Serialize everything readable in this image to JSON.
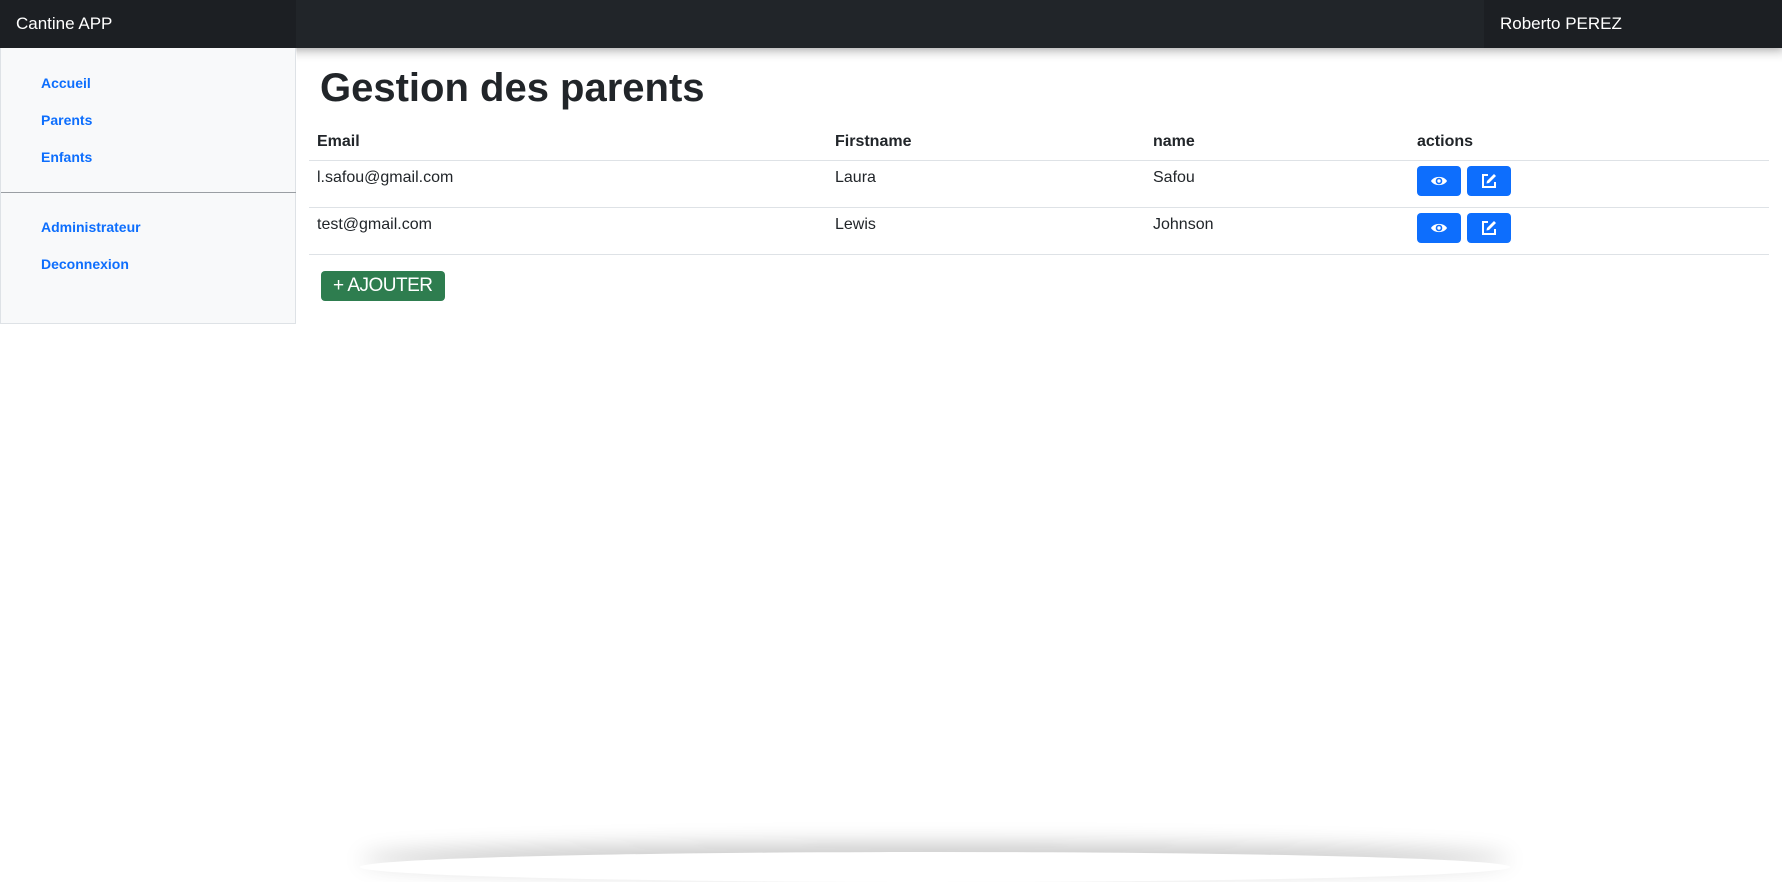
{
  "navbar": {
    "brand": "Cantine APP",
    "user": "Roberto PEREZ"
  },
  "sidebar": {
    "items": [
      {
        "label": "Accueil"
      },
      {
        "label": "Parents"
      },
      {
        "label": "Enfants"
      }
    ],
    "secondary_items": [
      {
        "label": "Administrateur"
      },
      {
        "label": "Deconnexion"
      }
    ]
  },
  "main": {
    "title": "Gestion des parents",
    "table": {
      "headers": [
        "Email",
        "Firstname",
        "name",
        "actions"
      ],
      "rows": [
        {
          "email": "l.safou@gmail.com",
          "firstname": "Laura",
          "name": "Safou"
        },
        {
          "email": "test@gmail.com",
          "firstname": "Lewis",
          "name": "Johnson"
        }
      ]
    },
    "add_button": "+ AJOUTER"
  },
  "colors": {
    "navbar_bg": "#212529",
    "link": "#0d6efd",
    "action_button": "#0d6efd",
    "add_button": "#2e7d4f",
    "sidebar_bg": "#f8f9fa"
  },
  "icons": {
    "view": "eye-icon",
    "edit": "edit-icon"
  }
}
